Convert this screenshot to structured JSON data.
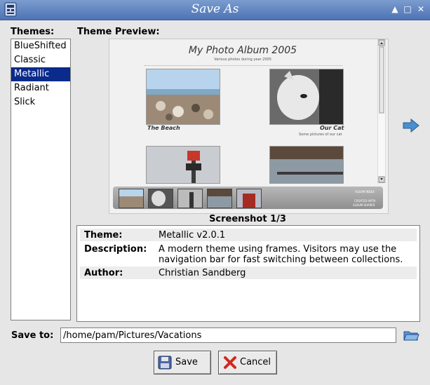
{
  "window": {
    "title": "Save As"
  },
  "themes": {
    "label": "Themes:",
    "items": [
      "BlueShifted",
      "Classic",
      "Metallic",
      "Radiant",
      "Slick"
    ],
    "selected": "Metallic"
  },
  "preview": {
    "label": "Theme Preview:",
    "album_title": "My Photo Album 2005",
    "album_subtitle": "Various photos during year 2005",
    "photo1_caption": "The Beach",
    "photo2_caption": "Our Cat",
    "photo2_subcaption": "Some pictures of our cat",
    "nav_label": "ALBUM INDEX",
    "nav_credit1": "CREATED WITH",
    "nav_credit2": "ALBUM SHAPER",
    "caption": "Screenshot 1/3"
  },
  "info": {
    "theme_key": "Theme:",
    "theme_value": "Metallic v2.0.1",
    "description_key": "Description:",
    "description_value": "A modern theme using frames. Visitors may use the navigation bar for fast switching between collections.",
    "author_key": "Author:",
    "author_value": "Christian Sandberg"
  },
  "save": {
    "label": "Save to:",
    "path": "/home/pam/Pictures/Vacations"
  },
  "buttons": {
    "save": "Save",
    "cancel": "Cancel"
  },
  "colors": {
    "titlebar": "#5a7fbf",
    "selection": "#0a2a8c",
    "arrow": "#4a90d0"
  }
}
